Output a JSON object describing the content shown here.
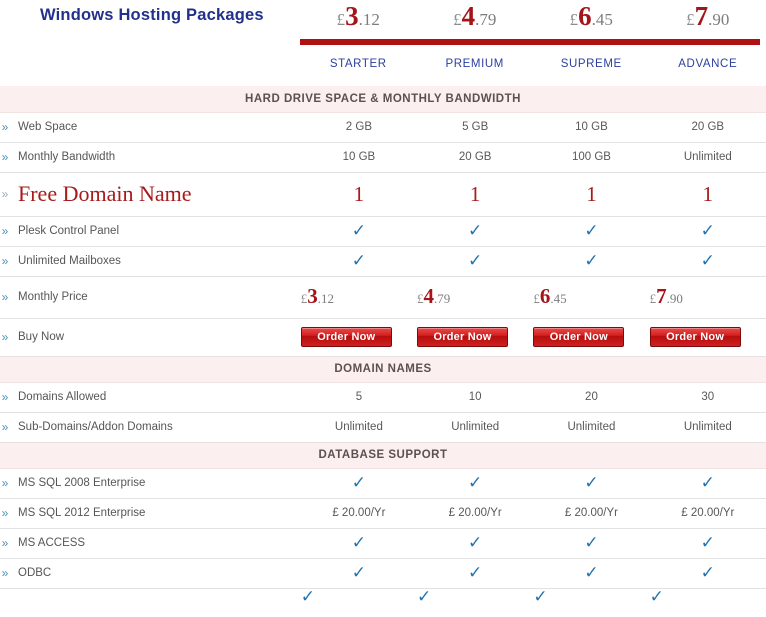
{
  "header": {
    "brand_title": "Windows Hosting Packages",
    "plans": [
      "STARTER",
      "PREMIUM",
      "SUPREME",
      "ADVANCE"
    ],
    "prices": [
      {
        "currency": "£",
        "whole": "3",
        "decimal": ".12"
      },
      {
        "currency": "£",
        "whole": "4",
        "decimal": ".79"
      },
      {
        "currency": "£",
        "whole": "6",
        "decimal": ".45"
      },
      {
        "currency": "£",
        "whole": "7",
        "decimal": ".90"
      }
    ],
    "accent_bar_color": "#AE1212",
    "title_color": "#22318C",
    "plan_label_color": "#2B3FA0"
  },
  "icons": {
    "chevron": "»",
    "check": "✓"
  },
  "sections": [
    {
      "title": "HARD DRIVE SPACE & MONTHLY BANDWIDTH"
    },
    {
      "title": "DOMAIN NAMES"
    },
    {
      "title": "DATABASE SUPPORT"
    }
  ],
  "rows": {
    "web_space": {
      "label": "Web Space",
      "values": [
        "2 GB",
        "5 GB",
        "10 GB",
        "20 GB"
      ]
    },
    "monthly_bw": {
      "label": "Monthly Bandwidth",
      "values": [
        "10 GB",
        "20 GB",
        "100 GB",
        "Unlimited"
      ]
    },
    "free_domain": {
      "label": "Free Domain Name",
      "values": [
        "1",
        "1",
        "1",
        "1"
      ]
    },
    "plesk": {
      "label": "Plesk Control Panel",
      "values": [
        "check",
        "check",
        "check",
        "check"
      ]
    },
    "mailboxes": {
      "label": "Unlimited Mailboxes",
      "values": [
        "check",
        "check",
        "check",
        "check"
      ]
    },
    "monthly_price": {
      "label": "Monthly Price"
    },
    "buy_now": {
      "label": "Buy Now",
      "button_label": "Order Now"
    },
    "domains_allowed": {
      "label": "Domains Allowed",
      "values": [
        "5",
        "10",
        "20",
        "30"
      ]
    },
    "subdomains": {
      "label": "Sub-Domains/Addon Domains",
      "values": [
        "Unlimited",
        "Unlimited",
        "Unlimited",
        "Unlimited"
      ]
    },
    "mssql2008": {
      "label": "MS SQL 2008 Enterprise",
      "values": [
        "check",
        "check",
        "check",
        "check"
      ]
    },
    "mssql2012": {
      "label": "MS SQL 2012 Enterprise",
      "values": [
        "£ 20.00/Yr",
        "£ 20.00/Yr",
        "£ 20.00/Yr",
        "£ 20.00/Yr"
      ]
    },
    "msaccess": {
      "label": "MS ACCESS",
      "values": [
        "check",
        "check",
        "check",
        "check"
      ]
    },
    "odbc": {
      "label": "ODBC",
      "values": [
        "check",
        "check",
        "check",
        "check"
      ]
    }
  },
  "colors": {
    "section_bg": "#FCEFEF",
    "check": "#2273B0",
    "price_red": "#A41419",
    "order_button": "#D41F1F"
  }
}
